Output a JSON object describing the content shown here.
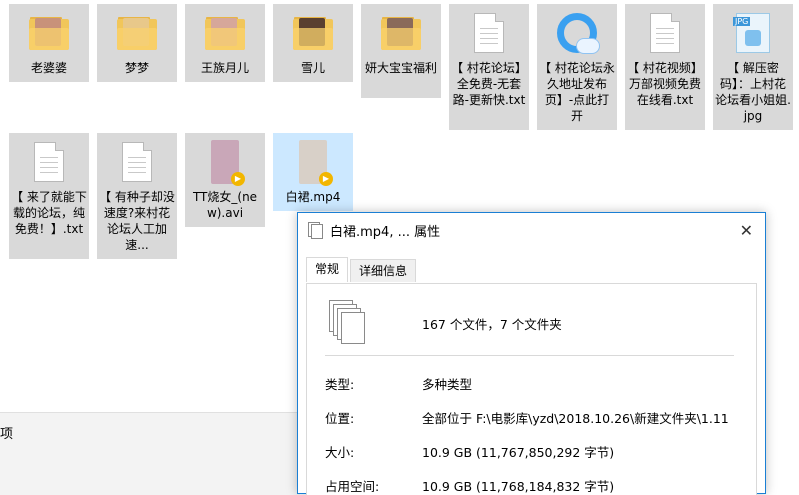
{
  "files_row1": [
    {
      "name": "老婆婆",
      "type": "folder",
      "photo_color": "#c8927a"
    },
    {
      "name": "梦梦",
      "type": "folder",
      "photo_color": "#e8c88a"
    },
    {
      "name": "王族月儿",
      "type": "folder",
      "photo_color": "#d6a79a"
    },
    {
      "name": "雪儿",
      "type": "folder",
      "photo_color": "#5a4030"
    },
    {
      "name": "妍大宝宝福利",
      "type": "folder",
      "photo_color": "#8a6a5a"
    },
    {
      "name": "【 村花论坛】全免费-无套路-更新快.txt",
      "type": "txt"
    },
    {
      "name": "【 村花论坛永久地址发布页】-点此打开",
      "type": "qq"
    },
    {
      "name": "【 村花视频】万部视频免费在线看.txt",
      "type": "txt"
    },
    {
      "name": "【 解压密码】：上村花论坛看小姐姐.jpg",
      "type": "jpg",
      "tag": "JPG"
    }
  ],
  "files_row2": [
    {
      "name": "【 来了就能下载的论坛，纯免费！】.txt",
      "type": "txt"
    },
    {
      "name": "【 有种子却没速度?来村花论坛人工加速...",
      "type": "txt"
    },
    {
      "name": "TT烧女_(new).avi",
      "type": "video",
      "thumb_color": "#c9a7b8"
    },
    {
      "name": "白裙.mp4",
      "type": "video",
      "thumb_color": "#d8d0c8"
    }
  ],
  "left_strip_text": "项",
  "dialog": {
    "title": "白裙.mp4, ... 属性",
    "close_glyph": "✕",
    "tabs": [
      "常规",
      "详细信息"
    ],
    "summary": "167 个文件，7 个文件夹",
    "rows": [
      {
        "key": "类型:",
        "value": "多种类型"
      },
      {
        "key": "位置:",
        "value": "全部位于 F:\\电影库\\yzd\\2018.10.26\\新建文件夹\\1.11"
      },
      {
        "key": "大小:",
        "value": "10.9 GB (11,767,850,292 字节)"
      },
      {
        "key": "占用空间:",
        "value": "10.9 GB (11,768,184,832 字节)"
      }
    ]
  },
  "colors": {
    "tile_bg": "#d9d9d9",
    "dialog_border": "#1a7fd4",
    "folder": "#f1c65a",
    "play_badge": "#f2b600",
    "qq_blue": "#3aa0f0"
  }
}
